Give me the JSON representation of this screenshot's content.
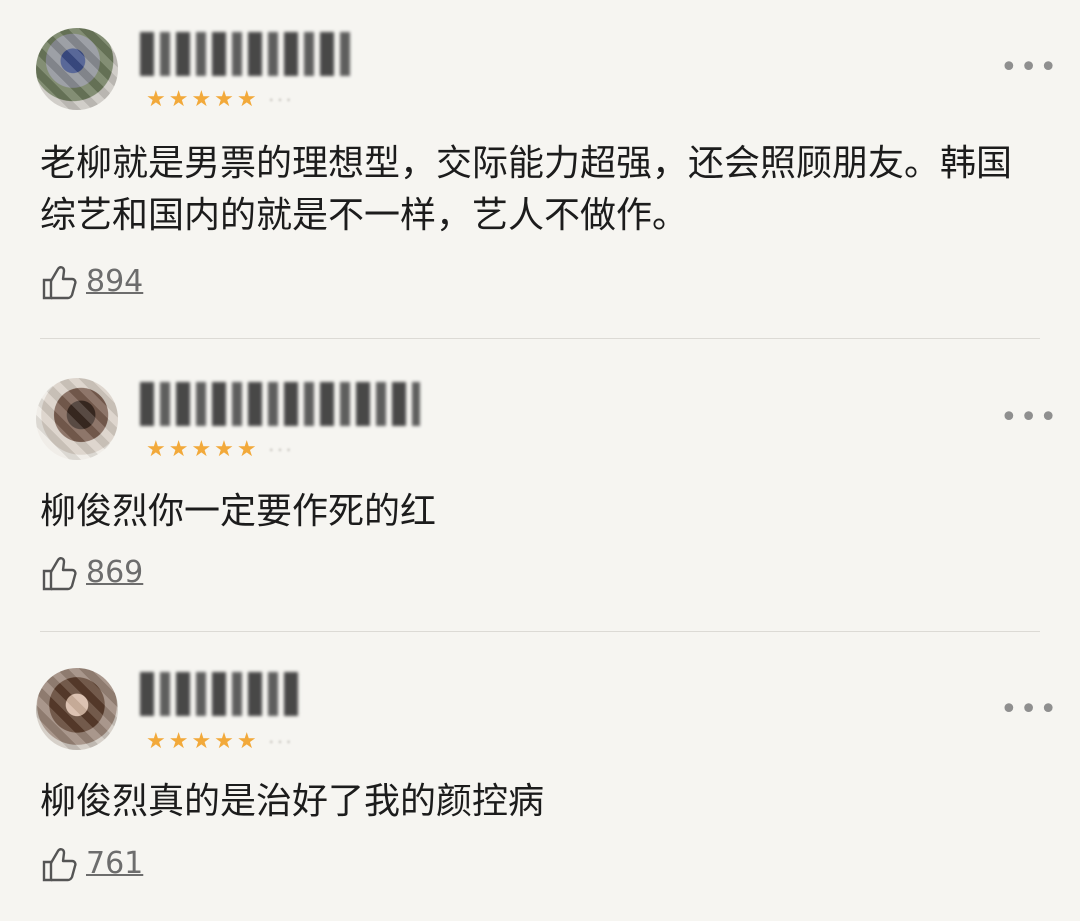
{
  "comments": [
    {
      "text": "老柳就是男票的理想型，交际能力超强，还会照顾朋友。韩国综艺和国内的就是不一样，艺人不做作。",
      "likes": "894",
      "stars_icon": "★★★★★",
      "more_icon": "•••"
    },
    {
      "text": "柳俊烈你一定要作死的红",
      "likes": "869",
      "stars_icon": "★★★★★",
      "more_icon": "•••"
    },
    {
      "text": "柳俊烈真的是治好了我的颜控病",
      "likes": "761",
      "stars_icon": "★★★★★",
      "more_icon": "•••"
    }
  ],
  "colors": {
    "accent_star": "#f2a93a",
    "background": "#f6f5f1"
  }
}
